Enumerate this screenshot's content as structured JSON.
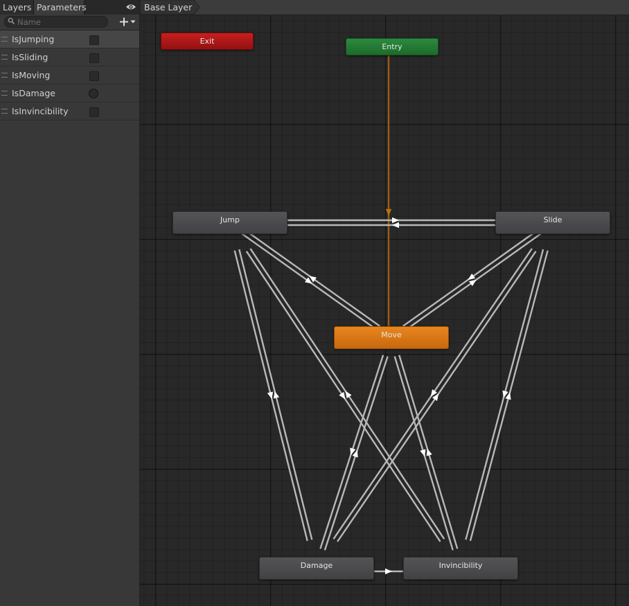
{
  "tabs": {
    "layers": "Layers",
    "parameters": "Parameters"
  },
  "icons": {
    "visibility": "eye-icon",
    "search": "search-icon",
    "add": "plus-icon",
    "add_menu": "chevron-down-icon"
  },
  "search": {
    "placeholder": "Name",
    "value": ""
  },
  "parameters": [
    {
      "name": "IsJumping",
      "type": "bool",
      "value": false,
      "selected": true
    },
    {
      "name": "IsSliding",
      "type": "bool",
      "value": false,
      "selected": false
    },
    {
      "name": "IsMoving",
      "type": "bool",
      "value": false,
      "selected": false
    },
    {
      "name": "IsDamage",
      "type": "trigger",
      "value": false,
      "selected": false
    },
    {
      "name": "IsInvincibility",
      "type": "bool",
      "value": false,
      "selected": false
    }
  ],
  "breadcrumb": {
    "layer": "Base Layer"
  },
  "states": {
    "exit": "Exit",
    "entry": "Entry",
    "jump": "Jump",
    "slide": "Slide",
    "move": "Move",
    "damage": "Damage",
    "invincibility": "Invincibility"
  },
  "transitions": [
    {
      "from": "Entry",
      "to": "Move"
    },
    {
      "from": "Jump",
      "to": "Slide"
    },
    {
      "from": "Slide",
      "to": "Jump"
    },
    {
      "from": "Jump",
      "to": "Move"
    },
    {
      "from": "Move",
      "to": "Jump"
    },
    {
      "from": "Slide",
      "to": "Move"
    },
    {
      "from": "Move",
      "to": "Slide"
    },
    {
      "from": "Jump",
      "to": "Damage"
    },
    {
      "from": "Damage",
      "to": "Jump"
    },
    {
      "from": "Jump",
      "to": "Invincibility"
    },
    {
      "from": "Invincibility",
      "to": "Jump"
    },
    {
      "from": "Slide",
      "to": "Damage"
    },
    {
      "from": "Damage",
      "to": "Slide"
    },
    {
      "from": "Slide",
      "to": "Invincibility"
    },
    {
      "from": "Invincibility",
      "to": "Slide"
    },
    {
      "from": "Move",
      "to": "Damage"
    },
    {
      "from": "Damage",
      "to": "Move"
    },
    {
      "from": "Move",
      "to": "Invincibility"
    },
    {
      "from": "Invincibility",
      "to": "Move"
    },
    {
      "from": "Damage",
      "to": "Invincibility"
    }
  ],
  "colors": {
    "exit": "#b81818",
    "entry": "#26803a",
    "default_state": "#e07a17",
    "state": "#4b4b4e",
    "transition": "#b8b8b8",
    "entry_transition": "#9a5c10",
    "graph_background": "#282828"
  }
}
